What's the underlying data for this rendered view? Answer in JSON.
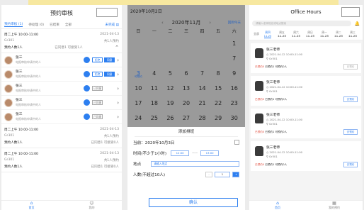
{
  "appointments": {
    "title": "预约审核",
    "tabs": [
      "预约审核 (1)",
      "待处理 (0)",
      "已结束",
      "全部"
    ],
    "filter": "未完成 ▤",
    "cards": [
      {
        "time": "周二上午 10:00-11:00",
        "date": "2021-04-13",
        "loc": "Gr301",
        "count": "共1人预约",
        "people_label": "预约人数1人",
        "status": "已同意1 可接受1人"
      }
    ],
    "people": [
      {
        "name": "张三",
        "sub": "电报审核申请中的人",
        "b1": "拒绝",
        "b2": "同意",
        "b1style": "b1"
      },
      {
        "name": "张三",
        "sub": "电报审核申请中的人",
        "b1": "拒绝",
        "b2": "同意",
        "b1style": "b1"
      },
      {
        "name": "张三",
        "sub": "电报审核申请中的人",
        "b1": "已同意",
        "b2": "",
        "b1style": "b3"
      },
      {
        "name": "张三",
        "sub": "电报审核申请中的人",
        "b1": "已同意",
        "b2": "",
        "b1style": "b3"
      },
      {
        "name": "张三",
        "sub": "电报审核申请中的人",
        "b1": "已同意",
        "b2": "",
        "b1style": "b3"
      }
    ],
    "more": [
      {
        "time": "周二上午 10:00-11:00",
        "date": "2021-04-13",
        "loc": "Gr301",
        "count": "共1人预约",
        "people_label": "预约人数1人",
        "status": "已同意1 可接受0人"
      },
      {
        "time": "周二上午 10:00-11:00",
        "date": "2021-04-13",
        "loc": "Gr301",
        "count": "共1人预约",
        "people_label": "预约人数1人",
        "status": "已同意1 可接受0人"
      }
    ],
    "nav": [
      "首页",
      "我的"
    ]
  },
  "calendar": {
    "header": "2020年10月2日",
    "month": "2020年11月",
    "today_btn": "回到今天",
    "weekdays": [
      "日",
      "一",
      "二",
      "三",
      "四",
      "五",
      "六"
    ],
    "days": [
      "",
      "",
      "",
      "",
      "",
      "",
      "",
      "",
      "",
      "",
      "",
      "",
      "",
      "",
      "",
      "",
      "",
      "",
      "",
      "",
      "",
      "",
      "",
      "",
      "",
      "",
      "",
      ""
    ]
  },
  "cal_rows": [
    [
      "",
      "",
      "",
      "",
      "",
      "",
      "1"
    ],
    [
      "",
      "",
      "",
      "",
      "",
      "",
      "7"
    ],
    [
      "3*",
      "4",
      "5",
      "6",
      "7",
      "8",
      "9"
    ],
    [
      "10",
      "11",
      "12",
      "13",
      "14",
      "15",
      "16"
    ],
    [
      "17",
      "18",
      "19",
      "20",
      "21",
      "22",
      "23"
    ],
    [
      "24",
      "25",
      "26",
      "27",
      "28",
      "29",
      "30"
    ]
  ],
  "cal_mark": "可预约",
  "modal": {
    "title": "添加排班",
    "current_label": "当前：2020年10月3日",
    "time_label": "时间(不少于1小时)",
    "time_from": "12:00",
    "time_sep": "——",
    "time_to": "13:00",
    "place_label": "地点",
    "place_placeholder": "请输入地点",
    "people_label": "人数(不超过10人)",
    "minus": "-",
    "count": "1",
    "plus": "+",
    "confirm": "确认"
  },
  "office": {
    "title": "Office Hours",
    "search_placeholder": "请输入老师姓名或地点搜索",
    "day_label": "全部",
    "days": [
      [
        "周四",
        "11.25"
      ],
      [
        "周五",
        "11.25"
      ],
      [
        "周六",
        "11.25"
      ],
      [
        "周日",
        "11.25"
      ],
      [
        "周一",
        "11.25"
      ],
      [
        "周二",
        "11.25"
      ],
      [
        "周三",
        "11.25"
      ]
    ],
    "cards": [
      {
        "name": "张三老师",
        "date": "2021-04-12 10:00-11:00",
        "loc": "Gr301",
        "status": "已预约0",
        "status2": "已预约1 可预约0人",
        "btn": "已预约",
        "dis": true
      },
      {
        "name": "张三老师",
        "date": "2021-04-12 10:00-11:00",
        "loc": "Gr301",
        "status": "已预约0",
        "status2": "已预约1 可预约0人",
        "btn": "去预约",
        "dis": false
      },
      {
        "name": "张三老师",
        "date": "2021-04-12 10:00-11:00",
        "loc": "Gr301",
        "status": "已预约0",
        "status2": "已预约1 可预约0人",
        "btn": "去预约",
        "dis": false
      },
      {
        "name": "张三老师",
        "date": "2021-04-12 10:00-11:00",
        "loc": "Gr301",
        "status": "已预约0",
        "status2": "已预约1 可预约0人",
        "btn": "去预约",
        "dis": false
      }
    ],
    "nav": [
      "首页",
      "我的预约"
    ]
  }
}
